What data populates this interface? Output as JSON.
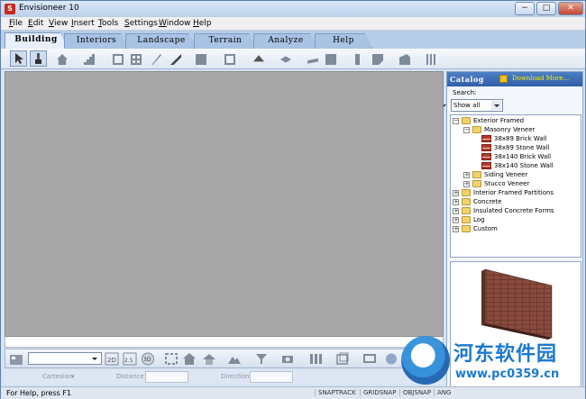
{
  "window": {
    "title": "Envisioneer 10",
    "app_icon_letter": "S",
    "controls": {
      "minimize": "−",
      "maximize": "□",
      "close": "✕"
    }
  },
  "menubar": {
    "items": [
      {
        "accel": "F",
        "rest": "ile"
      },
      {
        "accel": "E",
        "rest": "dit"
      },
      {
        "accel": "V",
        "rest": "iew"
      },
      {
        "accel": "I",
        "rest": "nsert"
      },
      {
        "accel": "T",
        "rest": "ools"
      },
      {
        "accel": "S",
        "rest": "ettings"
      },
      {
        "accel": "W",
        "rest": "indow"
      },
      {
        "accel": "H",
        "rest": "elp"
      }
    ]
  },
  "tabs": [
    {
      "label": "Building",
      "active": true
    },
    {
      "label": "Interiors",
      "active": false
    },
    {
      "label": "Landscape",
      "active": false
    },
    {
      "label": "Terrain",
      "active": false
    },
    {
      "label": "Analyze",
      "active": false
    },
    {
      "label": "Help",
      "active": false
    }
  ],
  "toolbar": {
    "icons": [
      "select-arrow-icon",
      "paint-brush-icon",
      "house-icon",
      "stair-icon",
      "window-frame-icon",
      "grid-window-icon",
      "door-icon",
      "wall-tool-icon",
      "roof-wizard-icon",
      "roof-icon",
      "floor-icon",
      "slab-icon",
      "foundation-icon",
      "column-icon",
      "cabinet-icon",
      "fence-icon",
      "railing-icon"
    ]
  },
  "catalog": {
    "title": "Catalog",
    "download_label": "Download More...",
    "search_label": "Search:",
    "search_value": "Show all",
    "tree": [
      {
        "label": "Exterior Framed",
        "level": 0,
        "kind": "folder",
        "expander": "−"
      },
      {
        "label": "Masonry Veneer",
        "level": 1,
        "kind": "folder",
        "expander": "−"
      },
      {
        "label": "38x89  Brick Wall",
        "level": 2,
        "kind": "item"
      },
      {
        "label": "38x89 Stone Wall",
        "level": 2,
        "kind": "item"
      },
      {
        "label": "38x140 Brick Wall",
        "level": 2,
        "kind": "item"
      },
      {
        "label": "38x140 Stone Wall",
        "level": 2,
        "kind": "item"
      },
      {
        "label": "Siding Veneer",
        "level": 1,
        "kind": "folder",
        "expander": "+"
      },
      {
        "label": "Stucco Veneer",
        "level": 1,
        "kind": "folder",
        "expander": "+"
      },
      {
        "label": "Interior Framed Partitions",
        "level": 0,
        "kind": "folder",
        "expander": "+"
      },
      {
        "label": "Concrete",
        "level": 0,
        "kind": "folder",
        "expander": "+"
      },
      {
        "label": "Insulated Concrete Forms",
        "level": 0,
        "kind": "folder",
        "expander": "+"
      },
      {
        "label": "Log",
        "level": 0,
        "kind": "folder",
        "expander": "+"
      },
      {
        "label": "Custom",
        "level": 0,
        "kind": "folder",
        "expander": "+"
      }
    ]
  },
  "bottom_toolbar": {
    "view_select_value": "",
    "icons": [
      "floorplan-icon",
      "2d-view-icon",
      "elevation-view-icon",
      "3d-view-icon",
      "zoom-extents-icon",
      "home-view-icon",
      "house-view-icon",
      "terrain-view-icon",
      "layer-icon",
      "camera-icon",
      "walls-icon",
      "cube-icon",
      "display-icon",
      "globe-icon"
    ]
  },
  "coordinates": {
    "mode_label": "Cartesian",
    "distance_label": "Distance",
    "direction_label": "Direction"
  },
  "status": {
    "help_text": "For Help, press F1",
    "indicators": [
      "SNAPTRACK",
      "GRIDSNAP",
      "OBJSNAP",
      "ANG"
    ]
  },
  "watermark": {
    "title": "河东软件园",
    "url": "www.pc0359.cn"
  },
  "colors": {
    "canvas": "#a8a8a8",
    "catalog_header": "#2f5fa8",
    "watermark": "#1c78d0"
  }
}
